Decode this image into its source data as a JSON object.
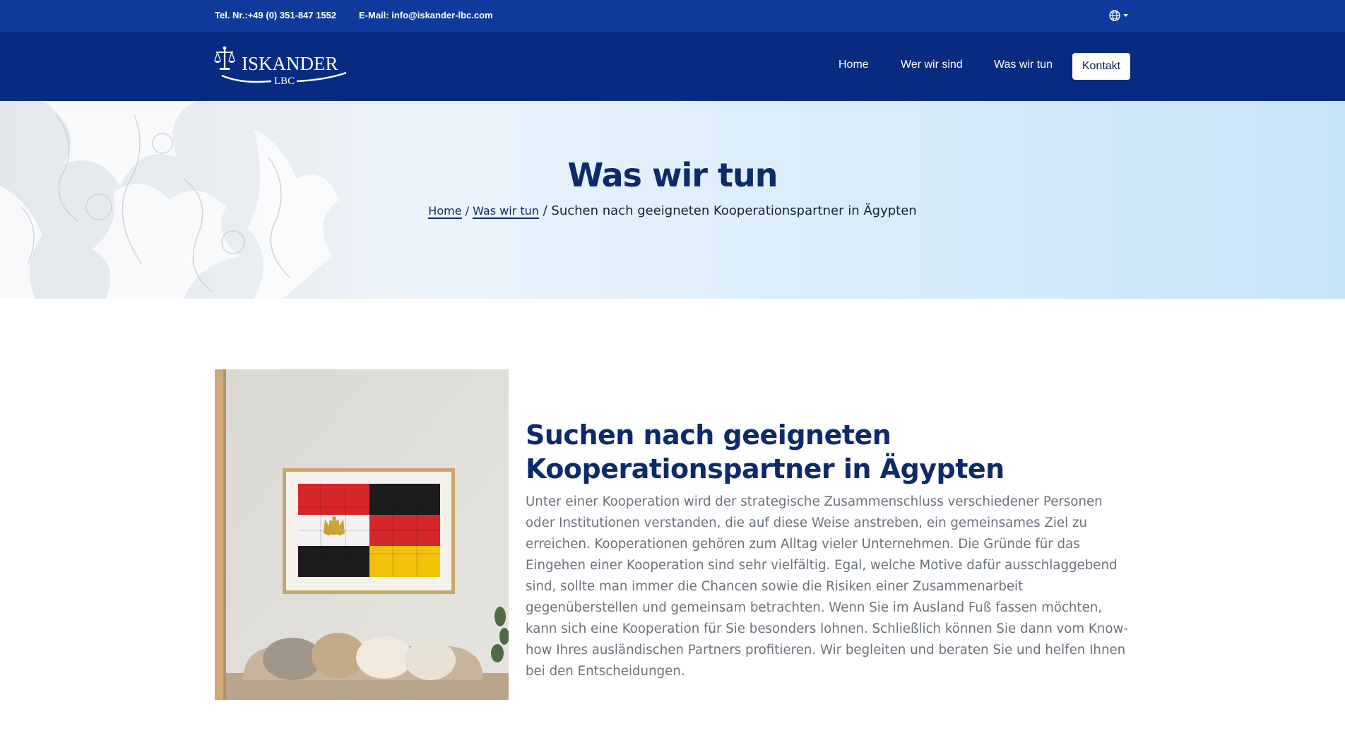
{
  "topbar": {
    "phone": "Tel. Nr.:+49 (0) 351-847 1552",
    "email": "E-Mail: info@iskander-lbc.com",
    "language_icon": "globe-icon"
  },
  "brand": {
    "name": "ISKANDER",
    "sub": "LBC",
    "logo_icon": "scales-of-justice-icon"
  },
  "nav": {
    "home": "Home",
    "wer_wir_sind": "Wer wir sind",
    "was_wir_tun": "Was wir tun",
    "kontakt": "Kontakt"
  },
  "hero": {
    "title": "Was wir tun",
    "breadcrumb": {
      "home": "Home",
      "sep1": " / ",
      "was_wir_tun": "Was wir tun",
      "sep2": " / ",
      "current": "Suchen nach geeigneten Kooperationspartner in Ägypten"
    }
  },
  "content": {
    "title": "Suchen nach geeigneten Kooperationspartner in Ägypten",
    "text": "Unter einer Kooperation wird der strategische Zusammenschluss verschiedener Personen oder Institutionen verstanden, die auf diese Weise anstreben, ein gemeinsames Ziel zu erreichen. Kooperationen gehören zum Alltag vieler Unternehmen. Die Gründe für das Eingehen einer Kooperation sind sehr vielfältig. Egal, welche Motive dafür ausschlaggebend sind, sollte man immer die Chancen sowie die Risiken einer Zusammenarbeit gegenüberstellen und gemeinsam betrachten. Wenn Sie im Ausland Fuß fassen möchten, kann sich eine Kooperation für Sie besonders lohnen. Schließlich können Sie dann vom Know-how Ihres ausländischen Partners profitieren. Wir begleiten und beraten Sie und helfen Ihnen bei den Entscheidungen.",
    "image_icon": "egypt-germany-puzzle-image"
  },
  "colors": {
    "topbar": "#0f3a9c",
    "navbar": "#062b81",
    "heading": "#0d2a6b",
    "body_text": "#6a727e"
  }
}
